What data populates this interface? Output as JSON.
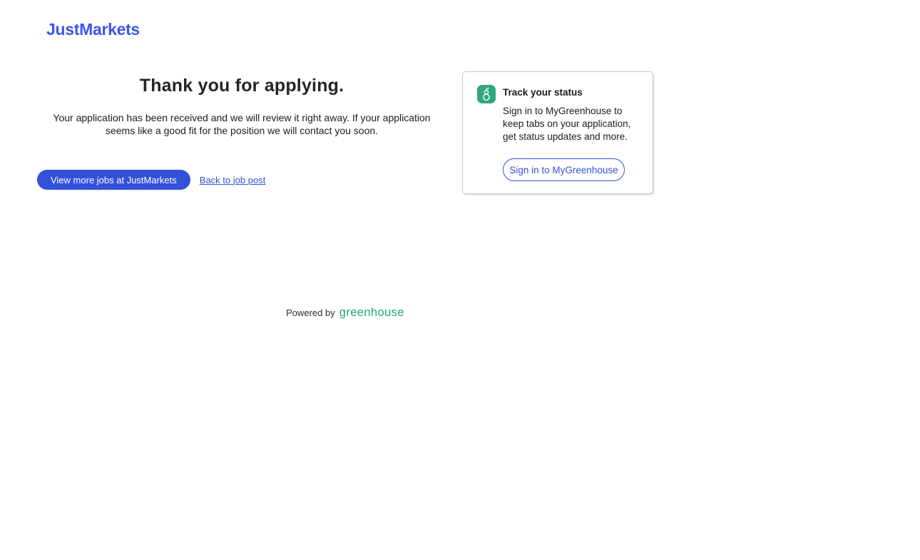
{
  "brand": {
    "logo_text": "JustMarkets"
  },
  "main": {
    "heading": "Thank you for applying.",
    "message": "Your application has been received and we will review it right away. If your application seems like a good fit for the position we will contact you soon.",
    "primary_button_label": "View more jobs at JustMarkets",
    "back_link_label": "Back to job post"
  },
  "status_card": {
    "icon": "greenhouse-g-icon",
    "title": "Track your status",
    "description": "Sign in to MyGreenhouse to keep tabs on your application, get status updates and more.",
    "signin_button_label": "Sign in to MyGreenhouse"
  },
  "footer": {
    "powered_by_label": "Powered by",
    "greenhouse_wordmark": "greenhouse"
  },
  "colors": {
    "accent_blue": "#3351db",
    "logo_blue": "#3b54f0",
    "greenhouse_icon_green": "#2fa97c",
    "greenhouse_wordmark_green": "#24a47f"
  }
}
